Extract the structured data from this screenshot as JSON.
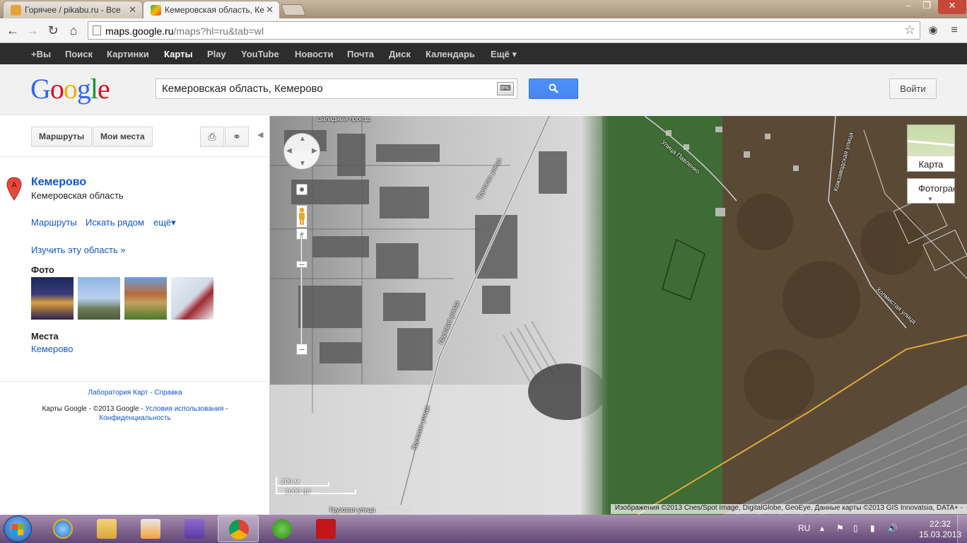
{
  "browser": {
    "tabs": [
      {
        "title": "Горячее / pikabu.ru - Все"
      },
      {
        "title": "Кемеровская область, Ке"
      }
    ],
    "url_domain": "maps.google.ru",
    "url_path": "/maps?hl=ru&tab=wl"
  },
  "gbar": {
    "items": [
      "+Вы",
      "Поиск",
      "Картинки",
      "Карты",
      "Play",
      "YouTube",
      "Новости",
      "Почта",
      "Диск",
      "Календарь",
      "Ещё ▾"
    ]
  },
  "header": {
    "logo": "Google",
    "search_value": "Кемеровская область, Кемерово",
    "signin_label": "Войти"
  },
  "panel": {
    "routes_button": "Маршруты",
    "myplaces_button": "Мои места",
    "pin_letter": "A",
    "place_title": "Кемерово",
    "place_subtitle": "Кемеровская область",
    "links": [
      "Маршруты",
      "Искать рядом",
      "ещё▾"
    ],
    "explore_link": "Изучить эту область »",
    "photos_heading": "Фото",
    "places_heading": "Места",
    "places_item": "Кемерово",
    "footer_links": "Лаборатория Карт - Справка",
    "footer_text": "Карты Google - ©2013 Google - ",
    "footer_terms": "Условия использования",
    "footer_sep": " - ",
    "footer_privacy": "Конфиденциальность"
  },
  "map": {
    "road_labels": [
      "Западный проезд",
      "Грузовая улица",
      "Грузовая улица",
      "Грузовая улица",
      "Грузовая улица",
      "Улица Павленко",
      "Кожзаводская улица",
      "Холмистая улица"
    ],
    "maptype_map_label": "Карта",
    "maptype_sat_label": "Фотографии",
    "scale_m": "200 м",
    "scale_ft": "1000 фт",
    "copyright": "Изображения ©2013 Cnes/Spot Image, DigitalGlobe, GeoEye, Данные карты ©2013 GIS Innovatsia, DATA+ -"
  },
  "taskbar": {
    "lang": "RU",
    "time": "22:32",
    "date": "15.03.2013"
  },
  "colors": {
    "gbar_bg": "#2d2d2d",
    "link": "#1155cc",
    "search_button": "#4d90fe"
  },
  "icons": [
    "back-icon",
    "forward-icon",
    "reload-icon",
    "home-icon",
    "star-icon",
    "print-icon",
    "link-icon",
    "search-icon",
    "keyboard-icon"
  ]
}
